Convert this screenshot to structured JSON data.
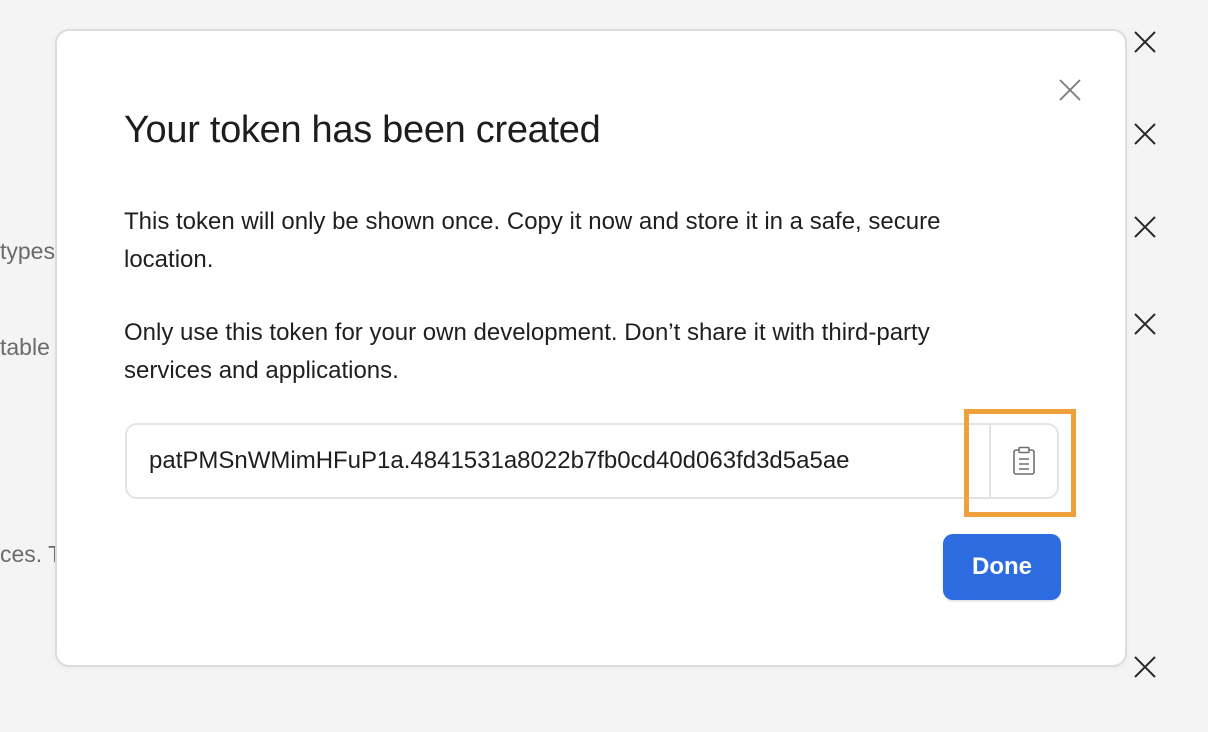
{
  "background": {
    "fragments": [
      "types",
      "table",
      "ces. T"
    ]
  },
  "modal": {
    "title": "Your token has been created",
    "paragraph_1": "This token will only be shown once. Copy it now and store it in a safe, secure location.",
    "paragraph_2": "Only use this token for your own development. Don’t share it with third-party services and applications.",
    "token_value": "patPMSnWMimHFuP1a.4841531a8022b7fb0cd40d063fd3d5a5ae",
    "copy_icon": "clipboard-icon",
    "close_icon": "close-icon",
    "done_label": "Done"
  },
  "colors": {
    "primary_button": "#2d6be0",
    "highlight": "#f0a03a"
  }
}
